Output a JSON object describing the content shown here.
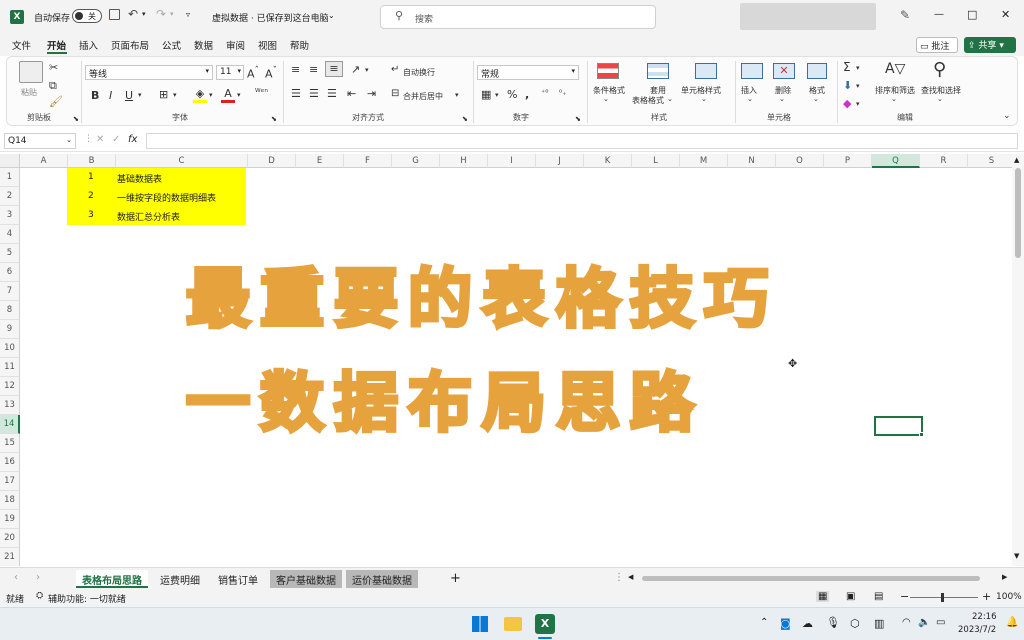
{
  "titlebar": {
    "autosave_label": "自动保存",
    "autosave_state": "关",
    "doc_title": "虚拟数据 · 已保存到这台电脑",
    "search_placeholder": "搜索",
    "min": "—",
    "max": "□",
    "close": "✕"
  },
  "menu": {
    "items": [
      "文件",
      "开始",
      "插入",
      "页面布局",
      "公式",
      "数据",
      "审阅",
      "视图",
      "帮助"
    ],
    "comment_btn": "批注",
    "share_btn": "共享"
  },
  "ribbon": {
    "paste": "粘贴",
    "clipboard": "剪贴板",
    "font_name": "等线",
    "font_size": "11",
    "font_group": "字体",
    "wrap": "自动换行",
    "merge": "合并后居中",
    "align_group": "对齐方式",
    "number_format": "常规",
    "number_group": "数字",
    "cond_format": "条件格式",
    "table_format_1": "套用",
    "table_format_2": "表格格式",
    "cell_style": "单元格样式",
    "style_group": "样式",
    "insert": "插入",
    "delete": "删除",
    "format": "格式",
    "cells_group": "单元格",
    "sort_filter": "排序和筛选",
    "find_select": "查找和选择",
    "edit_group": "编辑"
  },
  "formula_bar": {
    "name_box": "Q14",
    "fx": "fx",
    "content": ""
  },
  "columns": [
    "A",
    "B",
    "C",
    "D",
    "E",
    "F",
    "G",
    "H",
    "I",
    "J",
    "K",
    "L",
    "M",
    "N",
    "O",
    "P",
    "Q",
    "R",
    "S"
  ],
  "rows": [
    "1",
    "2",
    "3",
    "4",
    "5",
    "6",
    "7",
    "8",
    "9",
    "10",
    "11",
    "12",
    "13",
    "14",
    "15",
    "16",
    "17",
    "18",
    "19",
    "20",
    "21"
  ],
  "cells": [
    {
      "num": "1",
      "text": "基础数据表"
    },
    {
      "num": "2",
      "text": "一维按字段的数据明细表"
    },
    {
      "num": "3",
      "text": "数据汇总分析表"
    }
  ],
  "overlay": {
    "line1": "最重要的表格技巧",
    "line2": "一数据布局思路"
  },
  "sheets": {
    "tabs": [
      "表格布局思路",
      "运费明细",
      "销售订单",
      "客户基础数据",
      "运价基础数据"
    ],
    "active": 0,
    "add": "+"
  },
  "status": {
    "ready": "就绪",
    "accessibility": "辅助功能: 一切就绪",
    "zoom": "100%"
  },
  "taskbar": {
    "time": "22:16",
    "date": "2023/7/2"
  },
  "colors": {
    "accent": "#217346",
    "highlight": "#ffff00",
    "overlay_stroke": "#e6a23c"
  }
}
